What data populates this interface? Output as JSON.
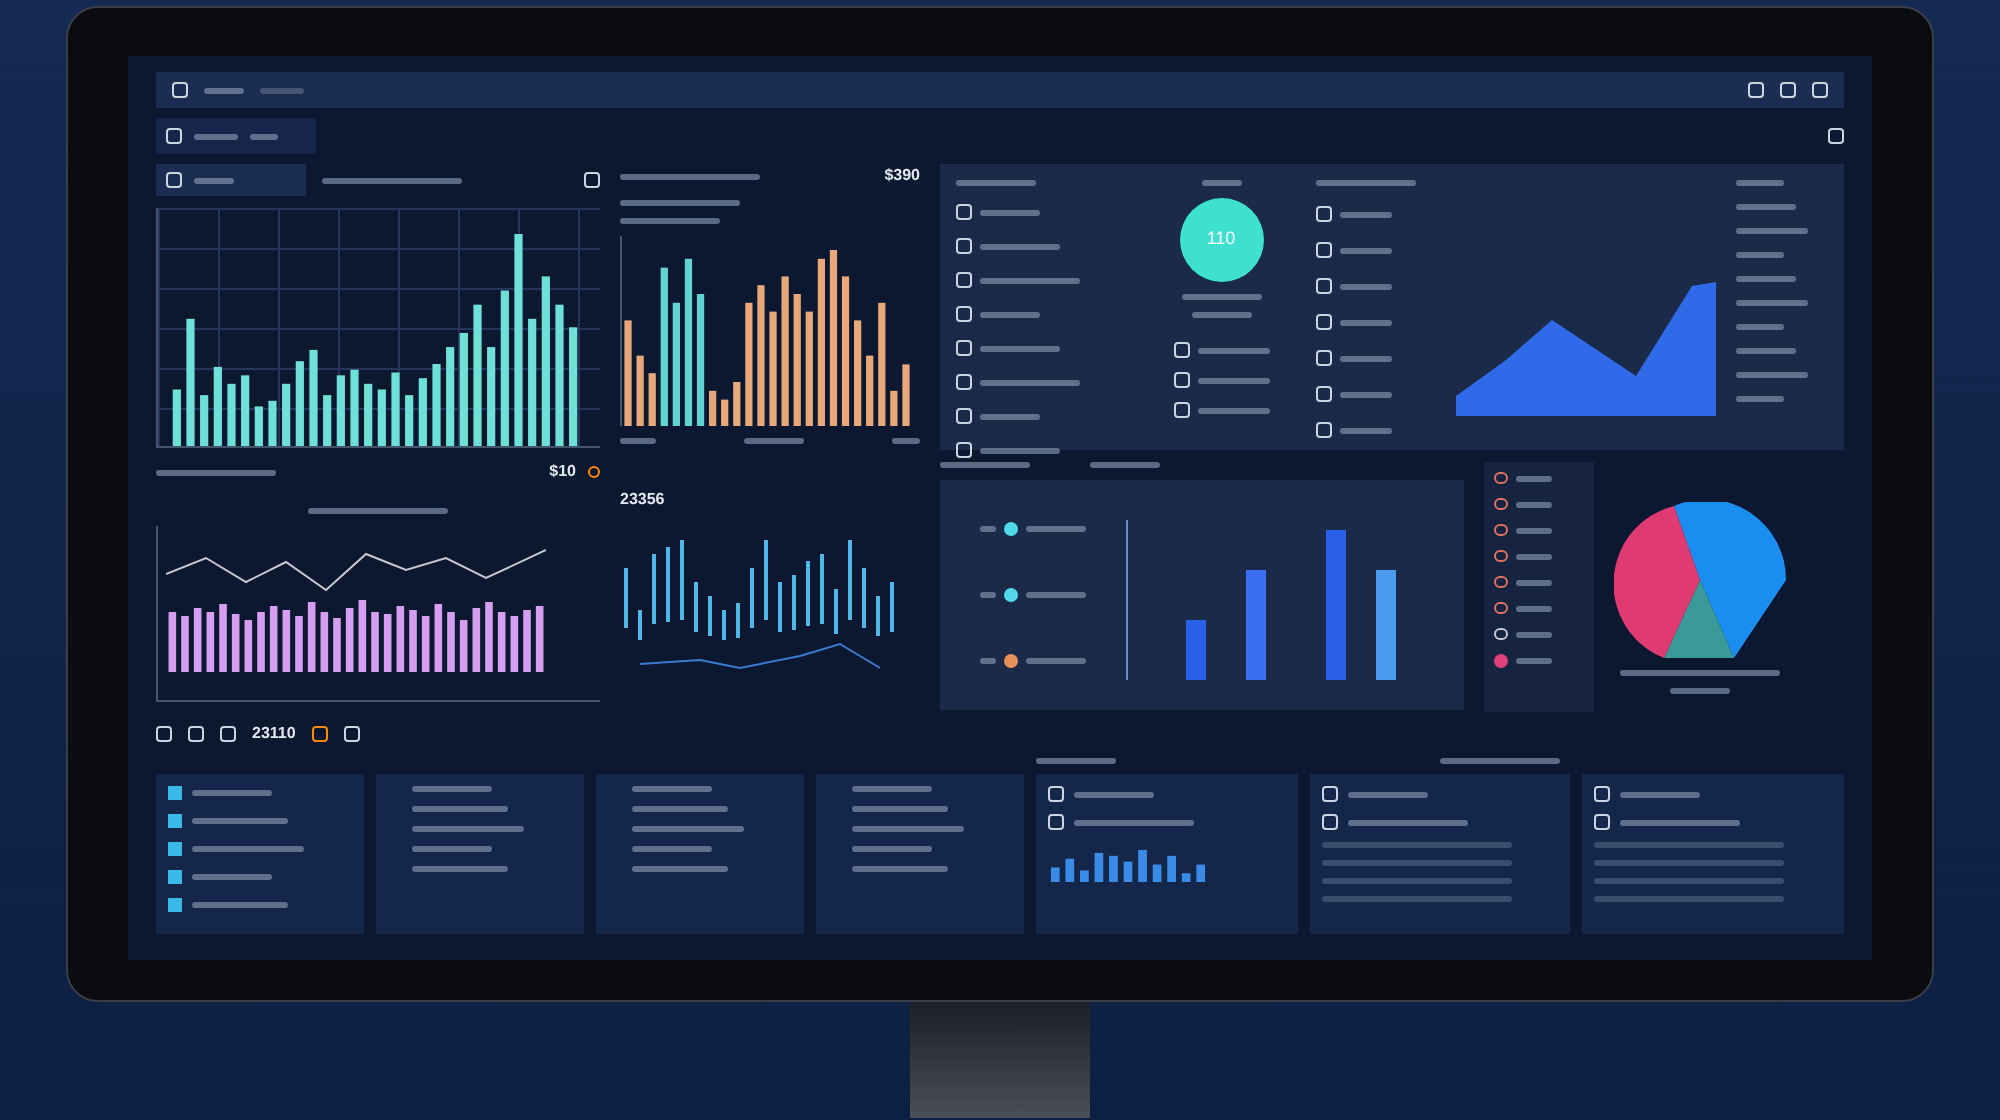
{
  "revenue_chart": {
    "value": "$10"
  },
  "orders_chart": {
    "value": "$390"
  },
  "gauge": {
    "value": "110"
  },
  "trend_chart": {
    "value": "23356"
  },
  "footer_value": {
    "value": "23110"
  },
  "bar_panel_dots": [
    {
      "color": "#4fd8e8"
    },
    {
      "color": "#4fd8e8"
    },
    {
      "color": "#e8905a"
    }
  ],
  "pie_legend": [
    {
      "kind": "ring",
      "color": "#e07060"
    },
    {
      "kind": "ring",
      "color": "#e07060"
    },
    {
      "kind": "ring",
      "color": "#e07060"
    },
    {
      "kind": "ring",
      "color": "#e07060"
    },
    {
      "kind": "ring",
      "color": "#e07060"
    },
    {
      "kind": "ring",
      "color": "#e07060"
    },
    {
      "kind": "ring",
      "color": "#c8c8d0"
    },
    {
      "kind": "dot",
      "color": "#e0407a"
    }
  ]
}
